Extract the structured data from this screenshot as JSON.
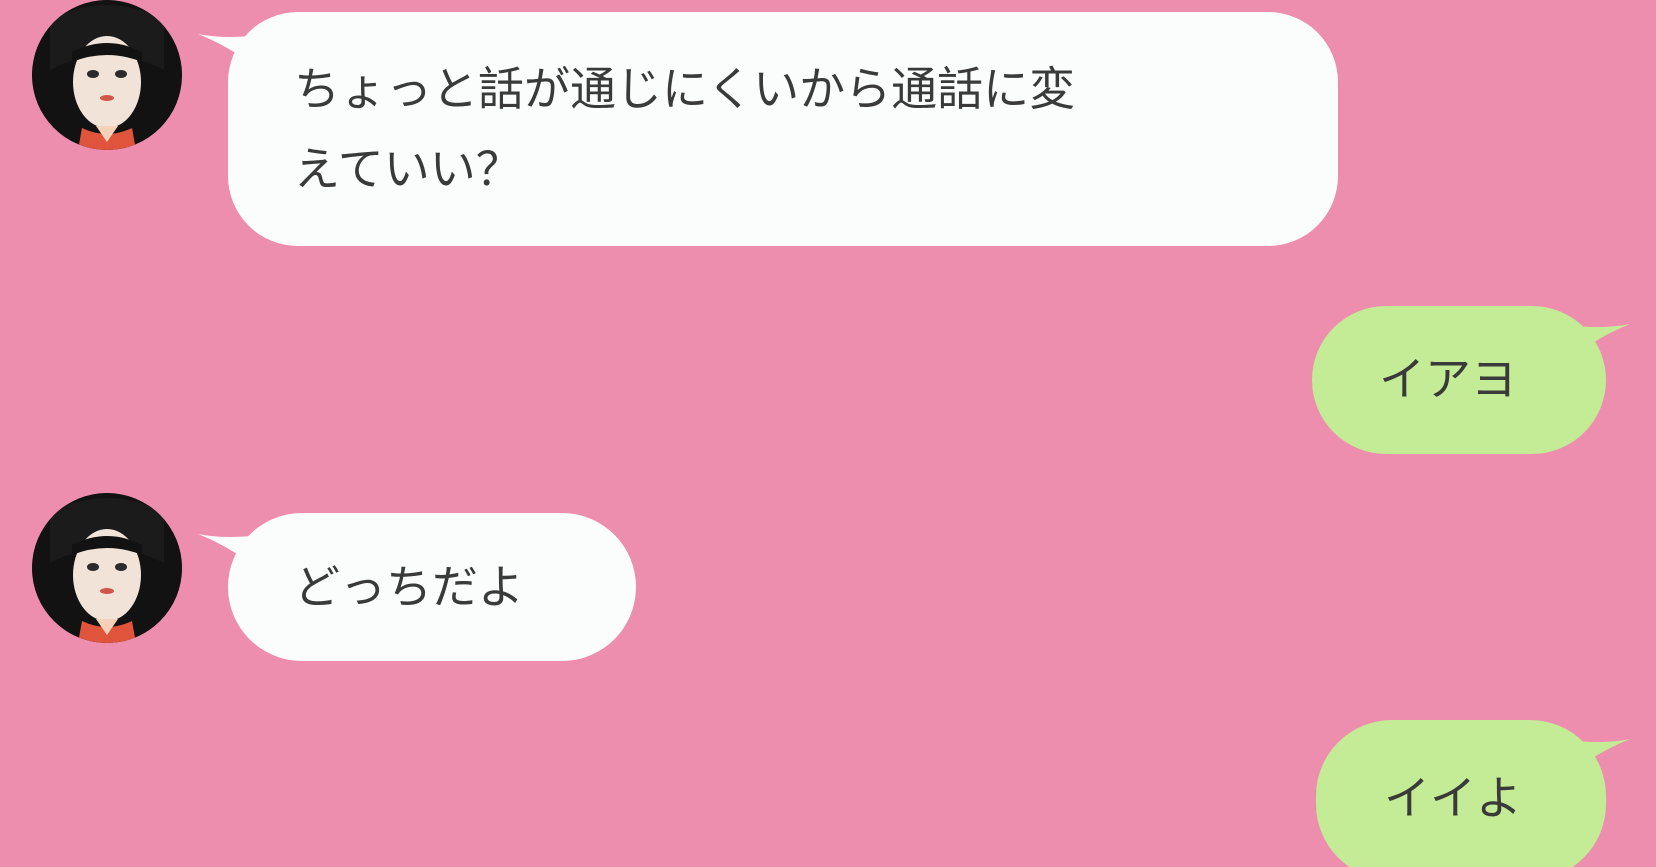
{
  "colors": {
    "background": "#ee8eae",
    "incoming_bubble": "#fbfdfd",
    "outgoing_bubble": "#c4eb95",
    "text": "#3a3a3a"
  },
  "messages": [
    {
      "sender": "other",
      "text": "ちょっと話が通じにくいから通話に変\nえていい？"
    },
    {
      "sender": "me",
      "text": "イアヨ"
    },
    {
      "sender": "other",
      "text": "どっちだよ"
    },
    {
      "sender": "me",
      "text": "イイよ"
    }
  ],
  "avatar": {
    "icon": "doll-avatar-icon"
  }
}
